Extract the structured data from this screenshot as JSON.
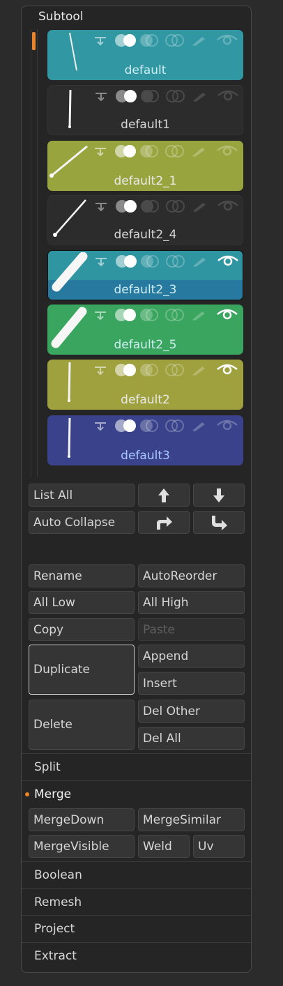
{
  "panel": {
    "title": "Subtool"
  },
  "subtools": [
    {
      "name": "default",
      "color": "teal",
      "eye": false
    },
    {
      "name": "default1",
      "color": "dark",
      "eye": false
    },
    {
      "name": "default2_1",
      "color": "olive",
      "eye": false
    },
    {
      "name": "default2_4",
      "color": "dark",
      "eye": false
    },
    {
      "name": "default2_3",
      "color": "selected",
      "eye": true
    },
    {
      "name": "default2_5",
      "color": "green",
      "eye": true
    },
    {
      "name": "default2",
      "color": "olive2",
      "eye": true
    },
    {
      "name": "default3",
      "color": "navy",
      "eye": false
    }
  ],
  "buttons": {
    "list_all": "List All",
    "auto_collapse": "Auto Collapse",
    "rename": "Rename",
    "auto_reorder": "AutoReorder",
    "all_low": "All Low",
    "all_high": "All High",
    "copy": "Copy",
    "paste": "Paste",
    "duplicate": "Duplicate",
    "append": "Append",
    "insert": "Insert",
    "delete": "Delete",
    "del_other": "Del Other",
    "del_all": "Del All",
    "merge_down": "MergeDown",
    "merge_similar": "MergeSimilar",
    "merge_visible": "MergeVisible",
    "weld": "Weld",
    "uv": "Uv"
  },
  "sections": {
    "split": "Split",
    "merge": "Merge",
    "boolean": "Boolean",
    "remesh": "Remesh",
    "project": "Project",
    "extract": "Extract"
  },
  "icons": {
    "move_up": "arrow-up-icon",
    "move_down": "arrow-down-icon",
    "move_right": "arrow-turn-right-icon",
    "move_down_right": "arrow-turn-down-right-icon"
  }
}
